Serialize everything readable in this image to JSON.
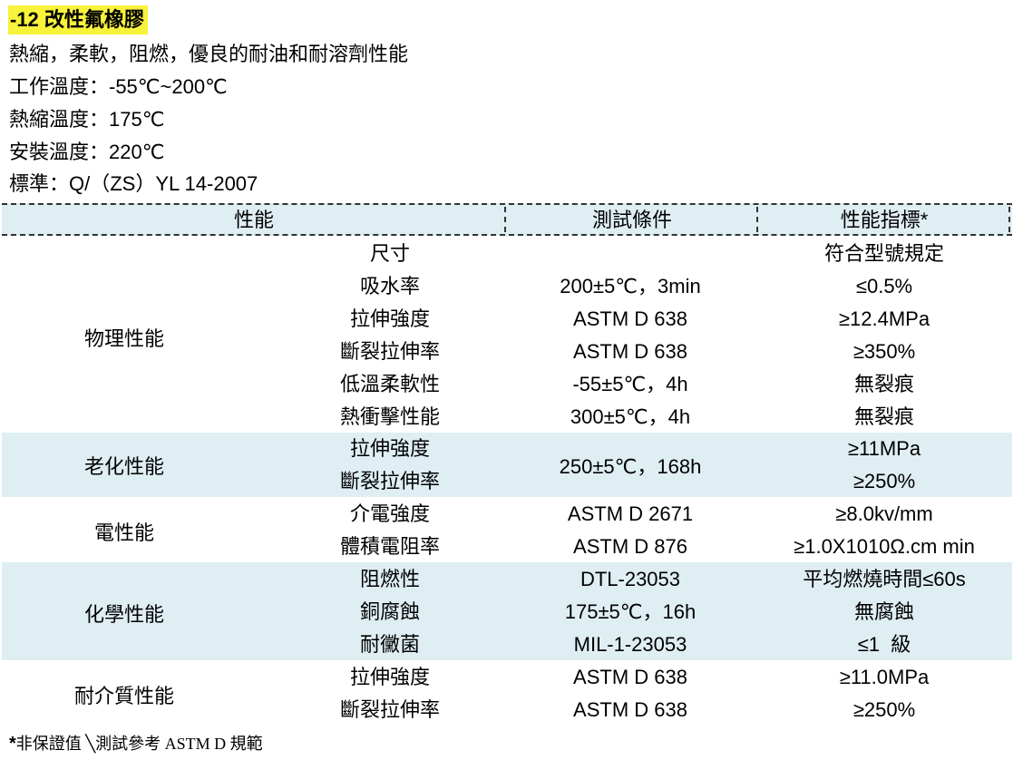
{
  "title": "-12 改性氟橡膠",
  "desc": {
    "features": "熱縮，柔軟，阻燃，優良的耐油和耐溶劑性能",
    "work_temp": "工作溫度：-55℃~200℃",
    "shrink_temp": "熱縮溫度：175℃",
    "install_temp": "安裝溫度：220℃",
    "standard": "標準：Q/（ZS）YL 14-2007"
  },
  "table": {
    "headers": [
      "性能",
      "測試條件",
      "性能指標*"
    ],
    "groups": [
      {
        "name": "物理性能",
        "rows": [
          {
            "item": "尺寸",
            "condition": "",
            "spec": "符合型號規定"
          },
          {
            "item": "吸水率",
            "condition": "200±5℃，3min",
            "spec": "≤0.5%"
          },
          {
            "item": "拉伸強度",
            "condition": "ASTM D 638",
            "spec": "≥12.4MPa"
          },
          {
            "item": "斷裂拉伸率",
            "condition": "ASTM D 638",
            "spec": "≥350%"
          },
          {
            "item": "低溫柔軟性",
            "condition": "-55±5℃，4h",
            "spec": "無裂痕"
          },
          {
            "item": "熱衝擊性能",
            "condition": "300±5℃，4h",
            "spec": "無裂痕"
          }
        ]
      },
      {
        "name": "老化性能",
        "merged_condition": "250±5℃，168h",
        "rows": [
          {
            "item": "拉伸強度",
            "spec": "≥11MPa"
          },
          {
            "item": "斷裂拉伸率",
            "spec": "≥250%"
          }
        ]
      },
      {
        "name": "電性能",
        "rows": [
          {
            "item": "介電強度",
            "condition": "ASTM D 2671",
            "spec": "≥8.0kv/mm"
          },
          {
            "item": "體積電阻率",
            "condition": "ASTM D 876",
            "spec": "≥1.0X1010Ω.cm min"
          }
        ]
      },
      {
        "name": "化學性能",
        "rows": [
          {
            "item": "阻燃性",
            "condition": "DTL-23053",
            "spec": "平均燃燒時間≤60s"
          },
          {
            "item": "銅腐蝕",
            "condition": "175±5℃，16h",
            "spec": "無腐蝕"
          },
          {
            "item": "耐黴菌",
            "condition": "MIL-1-23053",
            "spec": "≤1  級"
          }
        ]
      },
      {
        "name": "耐介質性能",
        "rows": [
          {
            "item": "拉伸強度",
            "condition": "ASTM D 638",
            "spec": "≥11.0MPa"
          },
          {
            "item": "斷裂拉伸率",
            "condition": "ASTM D 638",
            "spec": "≥250%"
          }
        ]
      }
    ]
  },
  "footnote": {
    "star": "*",
    "text": "非保證值 ╲測試參考 ASTM D 規範"
  },
  "colors": {
    "title_highlight": "#f7f23a",
    "band_tint": "#dfeef3"
  }
}
